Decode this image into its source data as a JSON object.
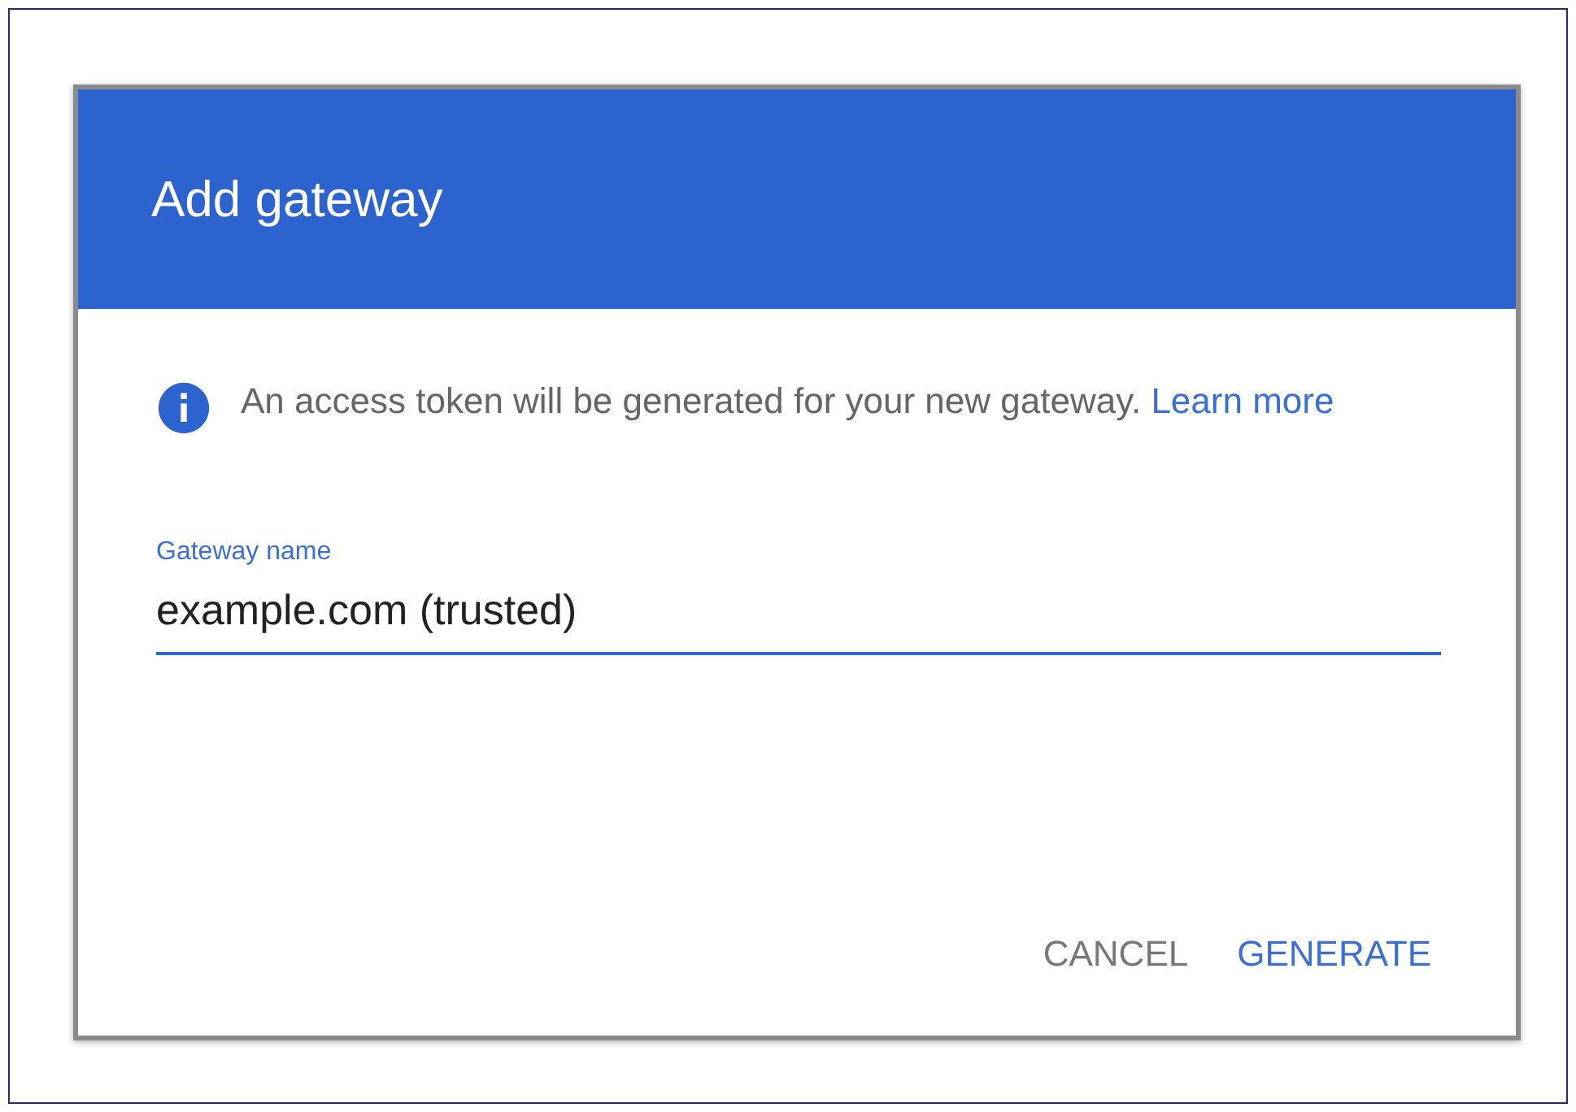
{
  "dialog": {
    "title": "Add gateway",
    "info": {
      "text": "An access token will be generated for your new gateway.",
      "link": "Learn more"
    },
    "field": {
      "label": "Gateway name",
      "value": "example.com (trusted)",
      "focused": true
    },
    "buttons": [
      {
        "label": "CANCEL",
        "kind": "secondary"
      },
      {
        "label": "GENERATE",
        "kind": "primary"
      }
    ]
  }
}
